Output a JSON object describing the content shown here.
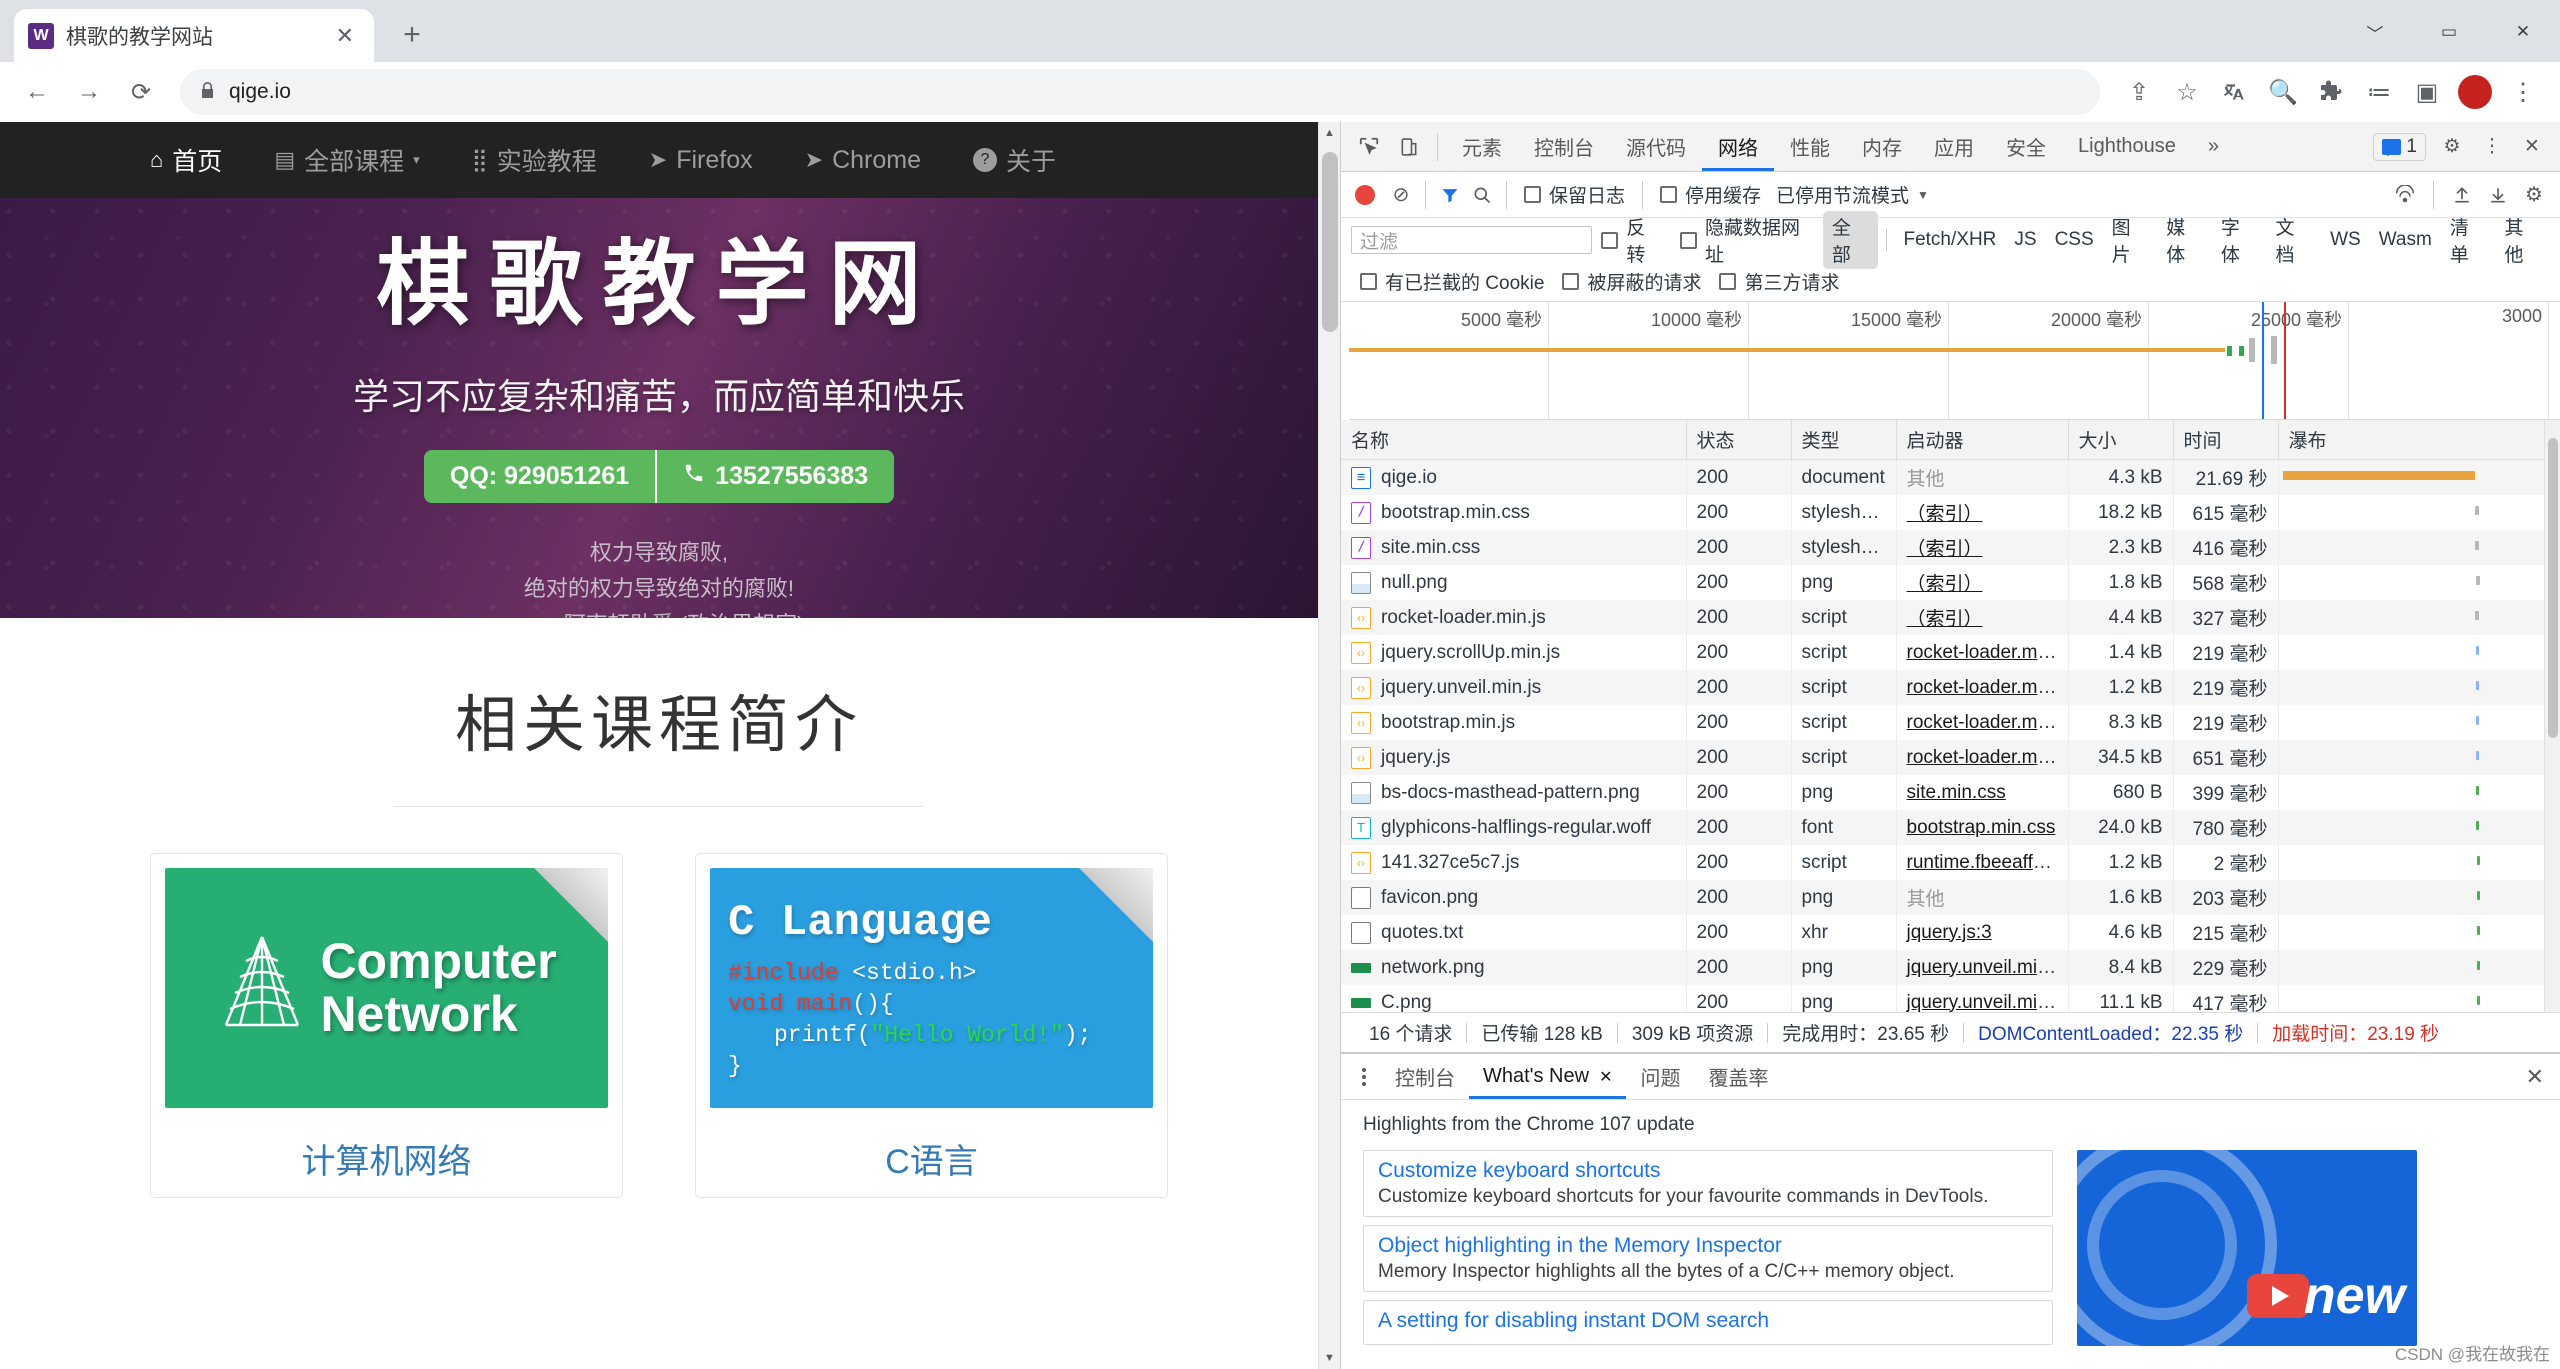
{
  "browser": {
    "tab": {
      "title": "棋歌的教学网站",
      "favicon_letter": "W",
      "close_icon": "✕"
    },
    "new_tab_icon": "+",
    "window_controls": {
      "minimize": "﹀",
      "restore": "▭",
      "close": "✕"
    },
    "toolbar": {
      "back_icon": "←",
      "forward_icon": "→",
      "reload_icon": "⟳",
      "lock_icon": "🔒",
      "url": "qige.io",
      "share_icon": "⇪",
      "star_icon": "☆",
      "translate_icon": "⇄",
      "search_icon": "🔍",
      "extensions_icon": "🧩",
      "reading_list_icon": "≔",
      "sidepanel_icon": "▣",
      "profile_initial": "",
      "menu_icon": "⋮"
    }
  },
  "site": {
    "nav": [
      {
        "icon": "⌂",
        "label": "首页"
      },
      {
        "icon": "▤",
        "label": "全部课程",
        "caret": "▾"
      },
      {
        "icon": "⣿",
        "label": "实验教程"
      },
      {
        "icon": "➤",
        "label": "Firefox"
      },
      {
        "icon": "➤",
        "label": "Chrome"
      },
      {
        "icon": "?",
        "label": "关于"
      }
    ],
    "hero": {
      "title": "棋歌教学网",
      "subtitle": "学习不应复杂和痛苦，而应简单和快乐",
      "btn_qq": "QQ: 929051261",
      "btn_phone_icon": "📞",
      "btn_phone": "13527556383",
      "quote_line1": "权力导致腐败,",
      "quote_line2": "绝对的权力导致绝对的腐败!",
      "quote_line3": "—— 阿克顿勋爵 (政治思想家)"
    },
    "section_title": "相关课程简介",
    "cards": [
      {
        "image_text_line1": "Computer",
        "image_text_line2": "Network",
        "title": "计算机网络",
        "color": "#27ae72"
      },
      {
        "image_head": "C  Language",
        "code_l1": "#include",
        "code_l1b": " <stdio.h>",
        "code_l2": "void main",
        "code_l2b": "(){",
        "code_l3a": "printf(",
        "code_l3b": "\"Hello World!\"",
        "code_l3c": ");",
        "code_l4": "}",
        "title": "C语言",
        "color": "#2a9fe0"
      }
    ],
    "scrollbar": {
      "up": "▲",
      "down": "▼"
    }
  },
  "devtools": {
    "inspect_icon": "⬉",
    "device_icon": "▯",
    "tabs": [
      {
        "label": "元素",
        "active": false
      },
      {
        "label": "控制台",
        "active": false
      },
      {
        "label": "源代码",
        "active": false
      },
      {
        "label": "网络",
        "active": true
      },
      {
        "label": "性能",
        "active": false
      },
      {
        "label": "内存",
        "active": false
      },
      {
        "label": "应用",
        "active": false
      },
      {
        "label": "安全",
        "active": false
      },
      {
        "label": "Lighthouse",
        "active": false
      }
    ],
    "more_tabs_icon": "»",
    "message_count": "1",
    "settings_icon": "⚙",
    "kebab_icon": "⋮",
    "close_icon": "✕",
    "network_toolbar": {
      "record_label": "record",
      "clear_icon": "⊘",
      "filter_icon": "▼",
      "search_icon": "🔍",
      "preserve_log": "保留日志",
      "disable_cache": "停用缓存",
      "throttle": "已停用节流模式",
      "throttle_caret": "▼",
      "wifi_icon": "☁",
      "import_icon": "⬆",
      "export_icon": "⬇",
      "settings_icon": "⚙"
    },
    "filter_bar": {
      "placeholder": "过滤",
      "invert": "反转",
      "hide_data_urls": "隐藏数据网址",
      "types": [
        "全部",
        "Fetch/XHR",
        "JS",
        "CSS",
        "图片",
        "媒体",
        "字体",
        "文档",
        "WS",
        "Wasm",
        "清单",
        "其他"
      ],
      "active_type": "全部",
      "blocked_cookies": "有已拦截的 Cookie",
      "blocked_requests": "被屏蔽的请求",
      "third_party": "第三方请求"
    },
    "overview_ticks": [
      "5000 毫秒",
      "10000 毫秒",
      "15000 毫秒",
      "20000 毫秒",
      "25000 毫秒",
      "3000"
    ],
    "table": {
      "columns": [
        "名称",
        "状态",
        "类型",
        "启动器",
        "大小",
        "时间",
        "瀑布"
      ],
      "rows": [
        {
          "name": "qige.io",
          "icon": "doc",
          "status": "200",
          "type": "document",
          "initiator": "其他",
          "initiator_link": false,
          "size": "4.3 kB",
          "time": "21.69 秒"
        },
        {
          "name": "bootstrap.min.css",
          "icon": "css",
          "status": "200",
          "type": "stylesheet",
          "initiator": "（索引）",
          "initiator_link": true,
          "size": "18.2 kB",
          "time": "615 毫秒"
        },
        {
          "name": "site.min.css",
          "icon": "css",
          "status": "200",
          "type": "stylesheet",
          "initiator": "（索引）",
          "initiator_link": true,
          "size": "2.3 kB",
          "time": "416 毫秒"
        },
        {
          "name": "null.png",
          "icon": "img",
          "status": "200",
          "type": "png",
          "initiator": "（索引）",
          "initiator_link": true,
          "size": "1.8 kB",
          "time": "568 毫秒"
        },
        {
          "name": "rocket-loader.min.js",
          "icon": "js",
          "status": "200",
          "type": "script",
          "initiator": "（索引）",
          "initiator_link": true,
          "size": "4.4 kB",
          "time": "327 毫秒"
        },
        {
          "name": "jquery.scrollUp.min.js",
          "icon": "js",
          "status": "200",
          "type": "script",
          "initiator": "rocket-loader.min…",
          "initiator_link": true,
          "size": "1.4 kB",
          "time": "219 毫秒"
        },
        {
          "name": "jquery.unveil.min.js",
          "icon": "js",
          "status": "200",
          "type": "script",
          "initiator": "rocket-loader.min…",
          "initiator_link": true,
          "size": "1.2 kB",
          "time": "219 毫秒"
        },
        {
          "name": "bootstrap.min.js",
          "icon": "js",
          "status": "200",
          "type": "script",
          "initiator": "rocket-loader.min…",
          "initiator_link": true,
          "size": "8.3 kB",
          "time": "219 毫秒"
        },
        {
          "name": "jquery.js",
          "icon": "js",
          "status": "200",
          "type": "script",
          "initiator": "rocket-loader.min…",
          "initiator_link": true,
          "size": "34.5 kB",
          "time": "651 毫秒"
        },
        {
          "name": "bs-docs-masthead-pattern.png",
          "icon": "img",
          "status": "200",
          "type": "png",
          "initiator": "site.min.css",
          "initiator_link": true,
          "size": "680 B",
          "time": "399 毫秒"
        },
        {
          "name": "glyphicons-halflings-regular.woff",
          "icon": "font",
          "status": "200",
          "type": "font",
          "initiator": "bootstrap.min.css",
          "initiator_link": true,
          "size": "24.0 kB",
          "time": "780 毫秒"
        },
        {
          "name": "141.327ce5c7.js",
          "icon": "js",
          "status": "200",
          "type": "script",
          "initiator": "runtime.fbeeaff4.j…",
          "initiator_link": true,
          "size": "1.2 kB",
          "time": "2 毫秒"
        },
        {
          "name": "favicon.png",
          "icon": "plain",
          "status": "200",
          "type": "png",
          "initiator": "其他",
          "initiator_link": false,
          "size": "1.6 kB",
          "time": "203 毫秒"
        },
        {
          "name": "quotes.txt",
          "icon": "plain",
          "status": "200",
          "type": "xhr",
          "initiator": "jquery.js:3",
          "initiator_link": true,
          "size": "4.6 kB",
          "time": "215 毫秒"
        },
        {
          "name": "network.png",
          "icon": "png-green",
          "status": "200",
          "type": "png",
          "initiator": "jquery.unveil.min…",
          "initiator_link": true,
          "size": "8.4 kB",
          "time": "229 毫秒"
        },
        {
          "name": "C.png",
          "icon": "png-green",
          "status": "200",
          "type": "png",
          "initiator": "jquery.unveil.min…",
          "initiator_link": true,
          "size": "11.1 kB",
          "time": "417 毫秒"
        }
      ]
    },
    "status_bar": {
      "requests": "16 个请求",
      "transferred": "已传输 128 kB",
      "resources": "309 kB 项资源",
      "finish": "完成用时：23.65 秒",
      "dcl": "DOMContentLoaded：22.35 秒",
      "load": "加载时间：23.19 秒"
    },
    "drawer": {
      "tabs": [
        {
          "label": "控制台",
          "active": false,
          "closable": false
        },
        {
          "label": "What's New",
          "active": true,
          "closable": true,
          "close_icon": "✕"
        },
        {
          "label": "问题",
          "active": false,
          "closable": false
        },
        {
          "label": "覆盖率",
          "active": false,
          "closable": false
        }
      ],
      "close_icon": "✕",
      "heading": "Highlights from the Chrome 107 update",
      "cards": [
        {
          "title": "Customize keyboard shortcuts",
          "desc": "Customize keyboard shortcuts for your favourite commands in DevTools."
        },
        {
          "title": "Object highlighting in the Memory Inspector",
          "desc": "Memory Inspector highlights all the bytes of a C/C++ memory object."
        },
        {
          "title": "A setting for disabling instant DOM search",
          "desc": ""
        }
      ],
      "video_label": "new"
    }
  },
  "watermark": "CSDN @我在故我在"
}
